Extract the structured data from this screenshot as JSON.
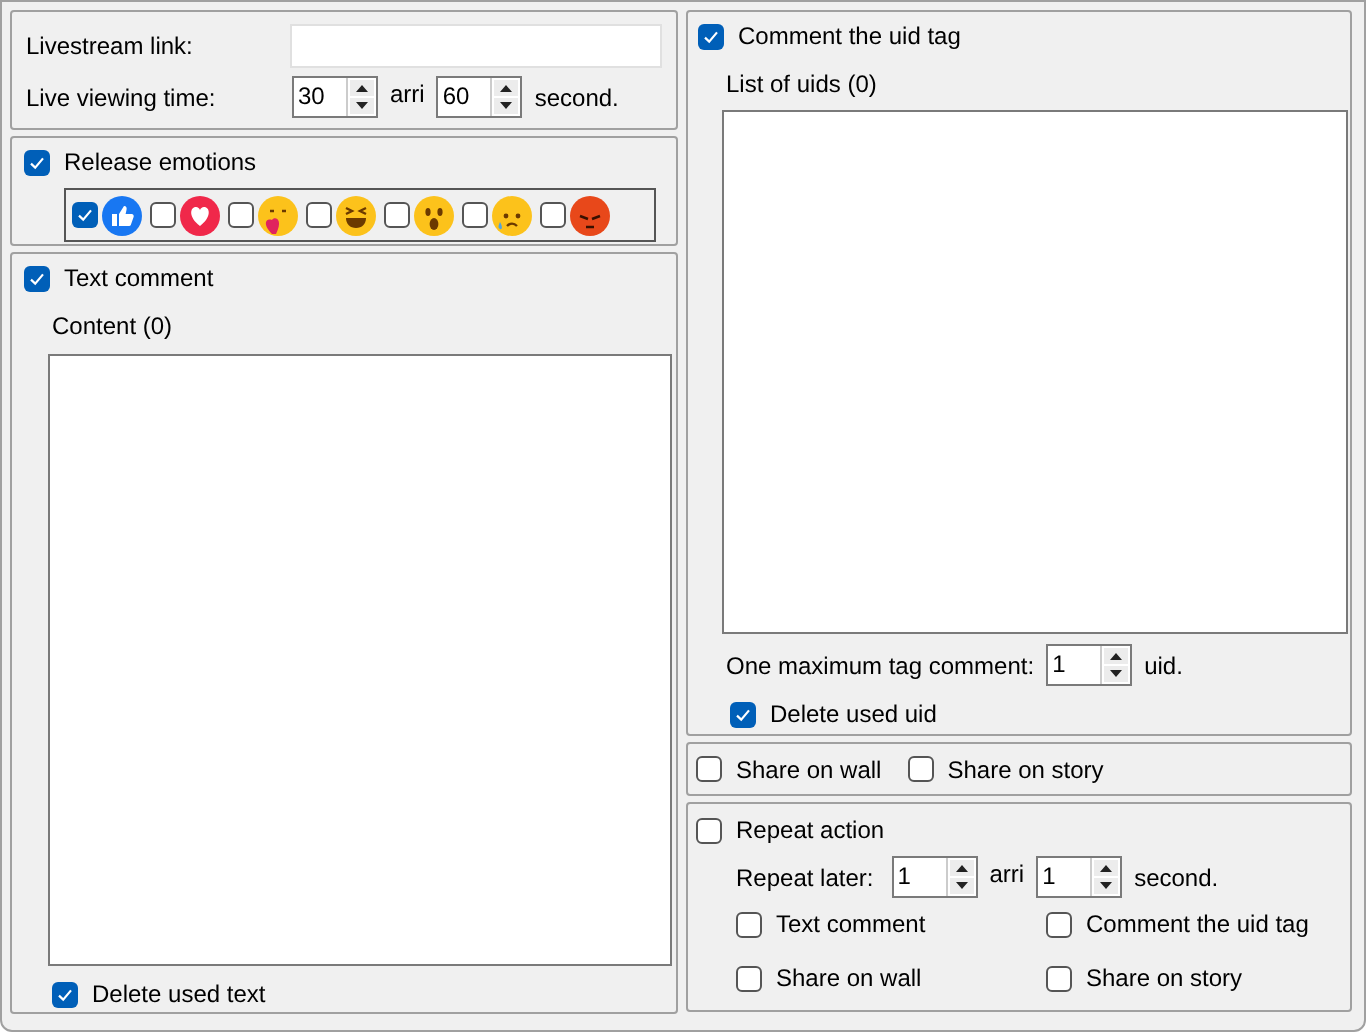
{
  "livestream_link": {
    "label": "Livestream link:"
  },
  "viewing_time": {
    "label": "Live viewing time:",
    "from": "30",
    "separator": "arri",
    "to": "60",
    "unit": "second."
  },
  "emotions": {
    "label": "Release emotions",
    "checked": true,
    "items": [
      {
        "kind": "like",
        "checked": true
      },
      {
        "kind": "love",
        "checked": false
      },
      {
        "kind": "care",
        "checked": false
      },
      {
        "kind": "haha",
        "checked": false
      },
      {
        "kind": "wow",
        "checked": false
      },
      {
        "kind": "sad",
        "checked": false
      },
      {
        "kind": "angry",
        "checked": false
      }
    ]
  },
  "text_comment": {
    "label": "Text comment",
    "checked": true,
    "content_label": "Content (0)",
    "delete_used": {
      "label": "Delete used text",
      "checked": true
    }
  },
  "uid_tag": {
    "label": "Comment the uid tag",
    "checked": true,
    "list_label": "List of uids (0)",
    "max_label": "One maximum tag comment:",
    "max_value": "1",
    "unit": "uid.",
    "delete_used": {
      "label": "Delete used uid",
      "checked": true
    }
  },
  "share": [
    {
      "label": "Share on wall",
      "checked": false
    },
    {
      "label": "Share on story",
      "checked": false
    }
  ],
  "repeat": {
    "label": "Repeat action",
    "checked": false,
    "later_label": "Repeat later:",
    "from": "1",
    "separator": "arri",
    "to": "1",
    "unit": "second.",
    "actions": [
      {
        "label": "Text comment",
        "checked": false
      },
      {
        "label": "Comment the uid tag",
        "checked": false
      },
      {
        "label": "Share on wall",
        "checked": false
      },
      {
        "label": "Share on story",
        "checked": false
      }
    ]
  }
}
